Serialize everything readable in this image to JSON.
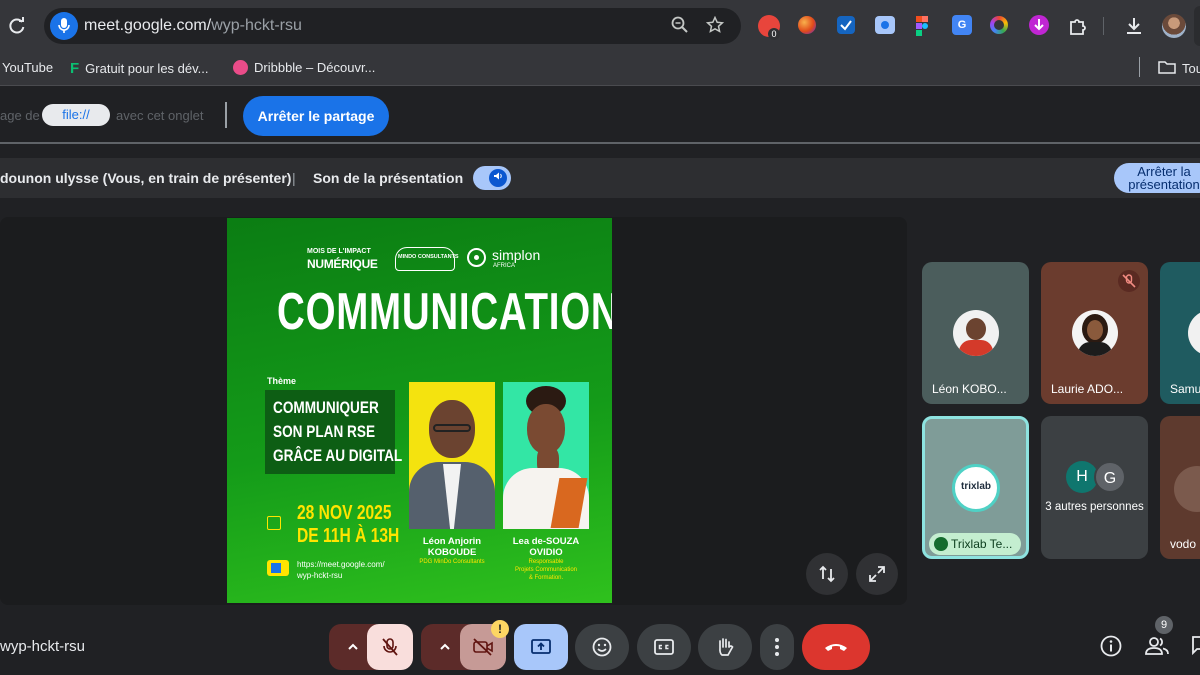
{
  "browser": {
    "url_host": "meet.google.com/",
    "url_path": "wyp-hckt-rsu",
    "ext_badge": "0",
    "bookmarks": [
      {
        "label": "YouTube"
      },
      {
        "label": "Gratuit pour les dév..."
      },
      {
        "label": "Dribbble – Découvr..."
      },
      {
        "label": "Tou"
      }
    ]
  },
  "share_bar": {
    "prefix_text": "age de",
    "file_chip": "file://",
    "suffix_text": "avec cet onglet",
    "stop_share_label": "Arrêter le partage"
  },
  "present_bar": {
    "presenter_text": "dounon ulysse (Vous, en train de présenter)",
    "separator": "|",
    "audio_label": "Son de la présentation",
    "stop_present_label": "Arrêter la présentation"
  },
  "slide": {
    "logo_1_line1": "MOIS DE L'IMPACT",
    "logo_1_line2": "NUMÉRIQUE",
    "logo_2": "MINDO CONSULTANTS",
    "logo_3": "simplon",
    "logo_3_sub": "AFRICA",
    "title": "COMMUNICATION",
    "theme_label": "Thème",
    "theme_line1": "COMMUNIQUER",
    "theme_line2": "SON PLAN RSE",
    "theme_line3": "GRÂCE AU DIGITAL",
    "date_line1": "28 NOV 2025",
    "date_line2": "DE 11H À 13H",
    "link_line1": "https://meet.google.com/",
    "link_line2": "wyp-hckt-rsu",
    "speaker1_name_line1": "Léon Anjorin",
    "speaker1_name_line2": "KOBOUDE",
    "speaker1_role": "PDG MinDo Consultants",
    "speaker2_name_line1": "Lea de-SOUZA",
    "speaker2_name_line2": "OVIDIO",
    "speaker2_role_line1": "Responsable",
    "speaker2_role_line2": "Projets Communication",
    "speaker2_role_line3": "& Formation."
  },
  "participants": [
    {
      "name": "Léon KOBO...",
      "color": "#4b5d5c"
    },
    {
      "name": "Laurie ADO...",
      "color": "#6b3c2e"
    },
    {
      "name": "Samu",
      "color": "#1f5b60"
    },
    {
      "name": "Trixlab Te...",
      "color": "#7f9c98",
      "logo": "trixlab"
    },
    {
      "name": "3 autres personnes",
      "color": "#3c4043",
      "initials": [
        "H",
        "G"
      ]
    },
    {
      "name": "vodo",
      "color": "#5e3a2e"
    }
  ],
  "bottom_bar": {
    "meeting_code": "wyp-hckt-rsu",
    "people_count": "9",
    "camera_warning": "!"
  },
  "colors": {
    "accent": "#1a73e8",
    "mute_red": "#f9dedc",
    "end_call": "#ea4335",
    "present_active": "#a8c7fa"
  }
}
